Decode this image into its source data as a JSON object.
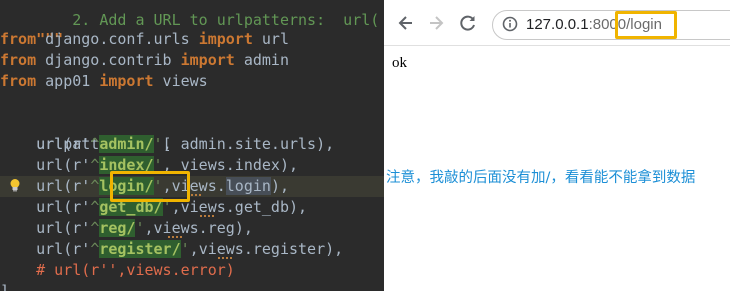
{
  "editor": {
    "lines": [
      {
        "top": "    2. Add a URL to urlpatterns:  url("
      },
      {
        "doc_close": "\"\"\""
      },
      {
        "kw": "from",
        "rest": " django.conf.urls ",
        "kw2": "import",
        "rest2": " url"
      },
      {
        "kw": "from",
        "rest": " django.contrib ",
        "kw2": "import",
        "rest2": " admin"
      },
      {
        "kw": "from",
        "rest": " app01 ",
        "kw2": "import",
        "rest2": " views"
      },
      {
        "assign": "urlpatterns = ["
      }
    ],
    "routes": [
      {
        "prefix": "url(r'",
        "caret": "^",
        "pattern": "admin/",
        "quote": "'",
        "sep": ", ",
        "view": "admin.site.urls",
        "end": "),"
      },
      {
        "prefix": "url(r'",
        "caret": "^",
        "pattern": "index/",
        "quote": "'",
        "sep": ", ",
        "view": "views.index",
        "end": "),"
      },
      {
        "prefix": "url(r'",
        "caret": "^",
        "pattern": "login/",
        "quote": "'",
        "sep": ",",
        "view_a": "views.",
        "view_b": "login",
        "end": "),"
      },
      {
        "prefix": "url(r'",
        "caret": "^",
        "pattern": "get_db/",
        "quote": "'",
        "sep": ",",
        "view": "views.get_db",
        "end": "),"
      },
      {
        "prefix": "url(r'",
        "caret": "^",
        "pattern": "reg/",
        "quote": "'",
        "sep": ",",
        "view": "views.reg",
        "end": "),"
      },
      {
        "prefix": "url(r'",
        "caret": "^",
        "pattern": "register/",
        "quote": "'",
        "sep": ",",
        "view": "views.register",
        "end": "),"
      }
    ],
    "comment": "# url(r'',views.error)",
    "closing": "]"
  },
  "browser": {
    "url_host": "127.0.0.1",
    "url_port": ":8000",
    "url_path": "/login",
    "page_text": "ok"
  },
  "annotation_text": "注意，我敲的后面没有加/，看看能不能拿到数据",
  "colors": {
    "editor_bg": "#2b2b2b",
    "highlight_box": "#f0b400",
    "annotation": "#1c8fd6"
  }
}
